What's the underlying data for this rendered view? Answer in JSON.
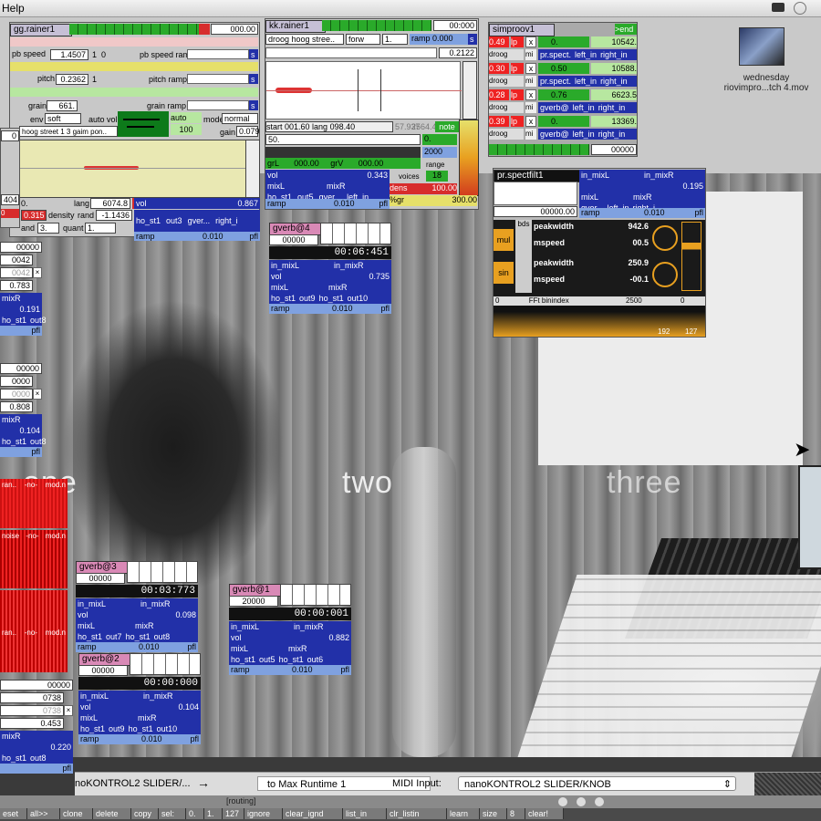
{
  "menubar": {
    "label": "Help"
  },
  "desktop": {
    "file_line1": "wednesday",
    "file_line2": "riovimpro...tch 4.mov"
  },
  "overlay_words": [
    "one",
    "two",
    "three"
  ],
  "gg_rainer": {
    "title": "gg.rainer1",
    "counter": "000.00",
    "pb_speed_label": "pb speed",
    "pb_speed": "1.4507",
    "pb_speed_one": "1",
    "pb_speed_zero": "0",
    "pb_speed_ramp": "pb speed ramp",
    "pitch_label": "pitch",
    "pitch": "0.2362",
    "pitch_one": "1",
    "pitch_ramp": "pitch ramp",
    "grain_label": "grain",
    "grain": "661.",
    "grain_ramp": "grain ramp",
    "env_label": "env",
    "env": "soft",
    "auto_vol": "auto vol",
    "auto_val": "auto",
    "auto_num": "100",
    "mode_label": "mode",
    "mode": "normal",
    "gain_label": "gain",
    "gain": "0.079",
    "s_btn": "s",
    "file": "hoog street 1 3 gaim pon..",
    "start": "0.",
    "lang_label": "lang",
    "lang": "6074.8",
    "fl_btn": "fl",
    "density_label": "density",
    "density": "0.315",
    "rand_label": "rand",
    "rand": "-1.1436",
    "and_label": "and",
    "and": "3.",
    "quant_label": "quant",
    "quant": "1.",
    "vol_label": "vol",
    "vol": "0.867",
    "out_left": "ho_st1",
    "out3": "out3",
    "gver": "gver...",
    "right_i": "right_i",
    "ramp": "ramp",
    "ramp_val": "0.010",
    "pfl": "pfl"
  },
  "kk_rainer": {
    "title": "kk.rainer1",
    "counter": "00:000",
    "file": "droog hoog stree..",
    "dir": "forw",
    "dir_num": "1.",
    "ramp_label": "ramp",
    "ramp_val": "0.000",
    "s_btn": "s",
    "num": "0.2122",
    "start": "start 001.60",
    "lang": "lang 098.40",
    "v1": "57.937",
    "v2": "2564.4",
    "note_btn": "note",
    "fifty": "50.",
    "zero": "0.",
    "twok": "2000",
    "range_label": "range",
    "voices_label": "voices",
    "voices": "18",
    "grL": "grL",
    "grL_val": "000.00",
    "grV": "grV",
    "grV_val": "000.00",
    "dens_label": "dens",
    "dens": "100.00",
    "gr_label": "%gr",
    "gr": "300.00",
    "mixL": "mixL",
    "mixR": "mixR",
    "vol_label": "vol",
    "vol": "0.343",
    "out_left": "ho_st1",
    "out5": "out5",
    "gver": "gver...",
    "left_in": "left_in",
    "ramp": "ramp",
    "ramp2": "0.010",
    "pfl": "pfl"
  },
  "simproov": {
    "title": "simproov1",
    "end_btn": ">end",
    "rows": [
      {
        "num": "0.49",
        "lp": "lp",
        "x": "x",
        "v": "0.",
        "out": "10542."
      },
      {
        "num": "0.30",
        "lp": "lp",
        "x": "x",
        "v": "0.50",
        "out": "10588."
      },
      {
        "num": "0.28",
        "lp": "lp",
        "x": "x",
        "v": "0.76",
        "out": "6623.5"
      },
      {
        "num": "0.39",
        "lp": "lp",
        "x": "x",
        "v": "0.",
        "out": "13369."
      }
    ],
    "routes": [
      {
        "a": "droog hoo.",
        "b": "mi",
        "c": "pr.spect.",
        "d": "left_in",
        "e": "right_in"
      },
      {
        "a": "droog hoo.",
        "b": "mi",
        "c": "pr.spect.",
        "d": "left_in",
        "e": "right_in"
      },
      {
        "a": "droog hoo.",
        "b": "mi",
        "c": "gverb@",
        "d": "left_in",
        "e": "right_in"
      },
      {
        "a": "droog hoo.",
        "b": "mi",
        "c": "gverb@",
        "d": "left_in",
        "e": "right_in"
      }
    ],
    "row_label_mi": "mi",
    "last_b": "pr.spect.",
    "footer": "00000"
  },
  "spectfilt": {
    "title": "pr.spectfilt1",
    "counter": "00000.00",
    "mixL": "in_mixL",
    "mixR": "in_mixR",
    "vol": "0.195",
    "mixL2": "mixL",
    "mixR2": "mixR",
    "gver": "gver...",
    "left_in": "left_in",
    "right_i": "right_i",
    "ramp": "ramp",
    "ramp_val": "0.010",
    "pfl": "pfl",
    "mul": "mul",
    "sin": "sin",
    "bds": "bds",
    "peakwidth1_label": "peakwidth",
    "peakwidth1": "942.6",
    "mspeed1_label": "mspeed",
    "mspeed1": "00.5",
    "peakwidth2_label": "peakwidth",
    "peakwidth2": "250.9",
    "mspeed2_label": "mspeed",
    "mspeed2": "-00.1",
    "fft_min": "0",
    "fft_label": "FFt binindex",
    "fft_max": "2500",
    "fft_zero": "0",
    "bin_low": "192",
    "bin_high": "127"
  },
  "gverbs": [
    {
      "title": "gverb@4",
      "val": "00000",
      "time": "00:06:451",
      "mixL": "in_mixL",
      "mixR": "in_mixR",
      "vol_label": "vol",
      "vol": "0.735",
      "mixL2": "mixL",
      "mixR2": "mixR",
      "o1": "ho_st1",
      "o2": "out9",
      "o3": "ho_st1",
      "o4": "out10",
      "ramp": "ramp",
      "ramp_val": "0.010",
      "pfl": "pfl"
    },
    {
      "title": "gverb@3",
      "val": "00000",
      "time": "00:03:773",
      "mixL": "in_mixL",
      "mixR": "in_mixR",
      "vol_label": "vol",
      "vol": "0.098",
      "mixL2": "mixL",
      "mixR2": "mixR",
      "o1": "ho_st1",
      "o2": "out7",
      "o3": "ho_st1",
      "o4": "out8",
      "ramp": "ramp",
      "ramp_val": "0.010",
      "pfl": "pfl"
    },
    {
      "title": "gverb@1",
      "val": "20000",
      "time": "00:00:001",
      "mixL": "in_mixL",
      "mixR": "in_mixR",
      "vol_label": "vol",
      "vol": "0.882",
      "mixL2": "mixL",
      "mixR2": "mixR",
      "o1": "ho_st1",
      "o2": "out5",
      "o3": "ho_st1",
      "o4": "out6",
      "ramp": "ramp",
      "ramp_val": "0.010",
      "pfl": "pfl"
    },
    {
      "title": "gverb@2",
      "val": "00000",
      "time": "00:00:000",
      "mixL": "in_mixL",
      "mixR": "in_mixR",
      "vol_label": "vol",
      "vol": "0.104",
      "mixL2": "mixL",
      "mixR2": "mixR",
      "o1": "ho_st1",
      "o2": "out9",
      "o3": "ho_st1",
      "o4": "out10",
      "ramp": "ramp",
      "ramp_val": "0.010",
      "pfl": "pfl"
    }
  ],
  "left_strips": [
    {
      "a": "00000",
      "b": "0042",
      "c": "0042",
      "d": "0.783",
      "mixR": "mixR",
      "vol": "0.191",
      "o1": "ho_st1",
      "o2": "out8",
      "pfl": "pfl"
    },
    {
      "a": "00000",
      "b": "0000",
      "c": "0000",
      "d": "0.808",
      "mixR": "mixR",
      "vol": "0.104",
      "o1": "ho_st1",
      "o2": "out8",
      "pfl": "pfl"
    },
    {
      "a": "00000",
      "b": "0738",
      "c": "0738",
      "d": "0.453",
      "mixR": "mixR",
      "vol": "0.220",
      "o1": "ho_st1",
      "o2": "out8",
      "pfl": "pfl"
    }
  ],
  "left_top": {
    "n1": "0",
    "n2": "404",
    "n3": "0",
    "mixL": "in_mixL",
    "vol": "0.867"
  },
  "red_tiles": [
    {
      "a": "ran..",
      "b": "-no-",
      "c": "mod.n"
    },
    {
      "a": "noise",
      "b": "-no-",
      "c": "mod.n"
    },
    {
      "a": "ran..",
      "b": "-no-",
      "c": "mod.n"
    }
  ],
  "midi": {
    "route_left": "noKONTROL2 SLIDER/...",
    "arrow": "→",
    "route_right": "to Max Runtime 1",
    "input_label": "MIDI Input:",
    "input_value": "nanoKONTROL2 SLIDER/KNOB"
  },
  "routing_label": "[routing]",
  "toolbar": {
    "items": [
      "eset",
      "all>>",
      "clone",
      "delete",
      "copy",
      "sel:",
      "0.",
      "1.",
      "127",
      "ignore",
      "clear_ignd",
      "list_in",
      "clr_listin",
      "learn",
      "size",
      "8",
      "clear!"
    ]
  },
  "colors": {
    "green": "#2aaa2a",
    "blue": "#2230a8",
    "pink": "#d989b6",
    "red": "#d72c2c",
    "lightblue": "#7fa1e0"
  }
}
